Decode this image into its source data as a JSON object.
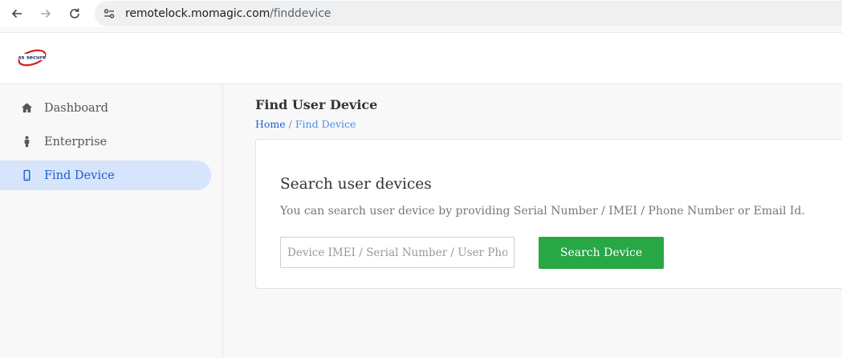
{
  "browser": {
    "url_host": "remotelock.momagic.com",
    "url_path": "/finddevice"
  },
  "header": {
    "logo_text": "ss secure"
  },
  "sidebar": {
    "items": [
      {
        "label": "Dashboard",
        "icon": "home-icon",
        "active": false
      },
      {
        "label": "Enterprise",
        "icon": "person-icon",
        "active": false
      },
      {
        "label": "Find Device",
        "icon": "mobile-icon",
        "active": true
      }
    ]
  },
  "main": {
    "title": "Find User Device",
    "breadcrumb": {
      "home": "Home",
      "separator": "/",
      "current": "Find Device"
    },
    "card": {
      "title": "Search user devices",
      "description": "You can search user device by providing Serial Number / IMEI / Phone Number or Email Id.",
      "search_placeholder": "Device IMEI / Serial Number / User Phone",
      "search_value": "",
      "search_button": "Search Device"
    }
  },
  "colors": {
    "accent": "#1d5fd0",
    "active_bg": "#d6e5fb",
    "button": "#28a745"
  }
}
